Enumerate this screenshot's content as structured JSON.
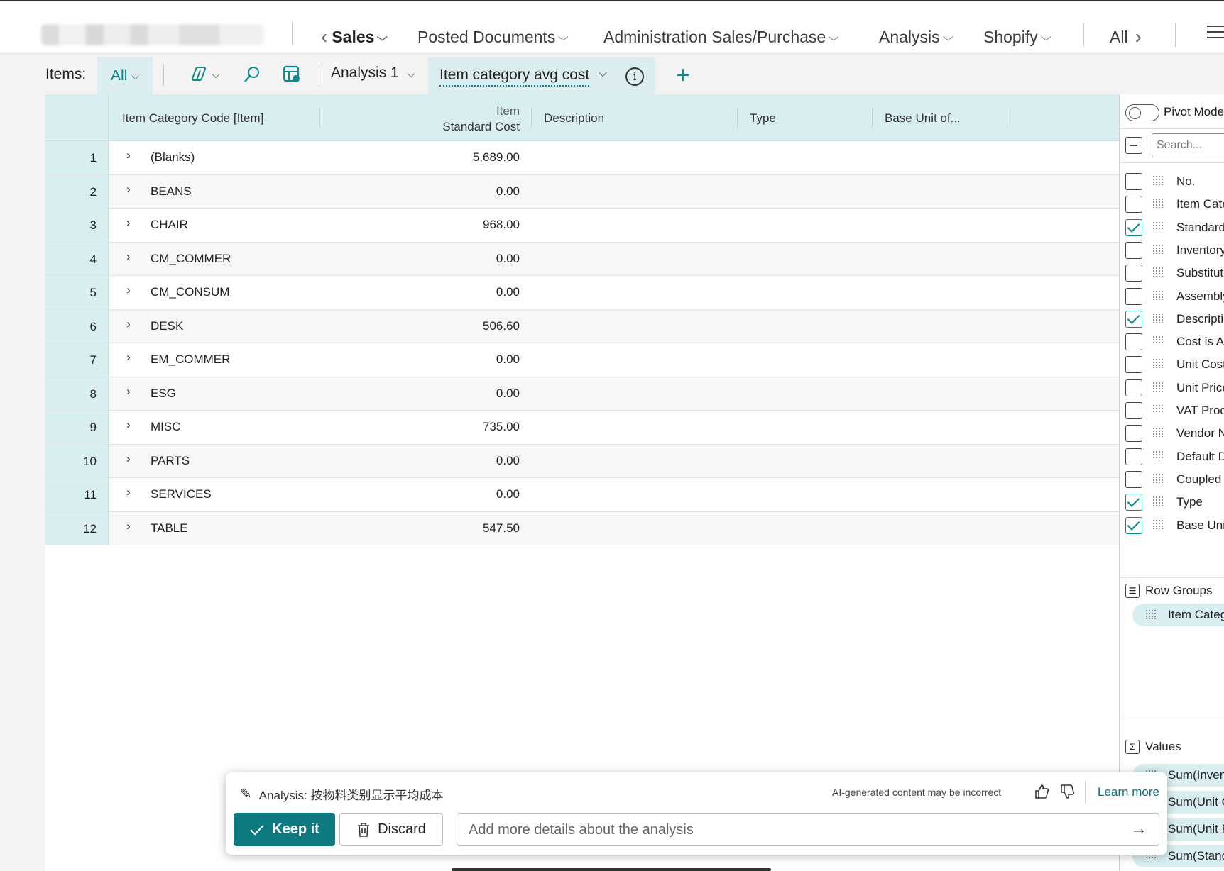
{
  "nav": {
    "items": [
      {
        "label": "Sales",
        "active": true
      },
      {
        "label": "Posted Documents"
      },
      {
        "label": "Administration Sales/Purchase"
      },
      {
        "label": "Analysis"
      },
      {
        "label": "Shopify"
      }
    ],
    "all_label": "All"
  },
  "toolbar": {
    "items_label": "Items:",
    "filter_value": "All",
    "analysis_label": "Analysis 1",
    "active_tab_label": "Item category avg cost"
  },
  "grid": {
    "headers": {
      "category": "Item Category Code [Item]",
      "cost_line1": "Item",
      "cost_line2": "Standard Cost",
      "description": "Description",
      "type": "Type",
      "base_unit": "Base Unit of..."
    },
    "rows": [
      {
        "num": "1",
        "code": "(Blanks)",
        "cost": "5,689.00"
      },
      {
        "num": "2",
        "code": "BEANS",
        "cost": "0.00"
      },
      {
        "num": "3",
        "code": "CHAIR",
        "cost": "968.00"
      },
      {
        "num": "4",
        "code": "CM_COMMER",
        "cost": "0.00"
      },
      {
        "num": "5",
        "code": "CM_CONSUM",
        "cost": "0.00"
      },
      {
        "num": "6",
        "code": "DESK",
        "cost": "506.60"
      },
      {
        "num": "7",
        "code": "EM_COMMER",
        "cost": "0.00"
      },
      {
        "num": "8",
        "code": "ESG",
        "cost": "0.00"
      },
      {
        "num": "9",
        "code": "MISC",
        "cost": "735.00"
      },
      {
        "num": "10",
        "code": "PARTS",
        "cost": "0.00"
      },
      {
        "num": "11",
        "code": "SERVICES",
        "cost": "0.00"
      },
      {
        "num": "12",
        "code": "TABLE",
        "cost": "547.50"
      }
    ]
  },
  "side": {
    "pivot_label": "Pivot Mode",
    "search_placeholder": "Search...",
    "columns": [
      {
        "label": "No.",
        "checked": false
      },
      {
        "label": "Item Category Code",
        "checked": false
      },
      {
        "label": "Standard Cost",
        "checked": true
      },
      {
        "label": "Inventory",
        "checked": false
      },
      {
        "label": "Substitutes Exist",
        "checked": false
      },
      {
        "label": "Assembly BOM",
        "checked": false
      },
      {
        "label": "Description",
        "checked": true
      },
      {
        "label": "Cost is Adjusted",
        "checked": false
      },
      {
        "label": "Unit Cost",
        "checked": false
      },
      {
        "label": "Unit Price",
        "checked": false
      },
      {
        "label": "VAT Prod. Posting Group",
        "checked": false
      },
      {
        "label": "Vendor No.",
        "checked": false
      },
      {
        "label": "Default Deferral Template",
        "checked": false
      },
      {
        "label": "Coupled to Dataverse",
        "checked": false
      },
      {
        "label": "Type",
        "checked": true
      },
      {
        "label": "Base Unit of Measure",
        "checked": true
      }
    ],
    "row_groups_label": "Row Groups",
    "row_groups": [
      "Item Category Code"
    ],
    "values_label": "Values",
    "values": [
      "Sum(Inventory)",
      "Sum(Unit Cost)",
      "Sum(Unit Price)",
      "Sum(Standard Cost)"
    ]
  },
  "copilot": {
    "title": "Analysis: 按物料类别显示平均成本",
    "disclaimer": "AI-generated content may be incorrect",
    "learn_more": "Learn more",
    "keep_label": "Keep it",
    "discard_label": "Discard",
    "input_placeholder": "Add more details about the analysis"
  },
  "colors": {
    "accent": "#0a8a8f",
    "header_bg": "#d9eef1",
    "keep_bg": "#0c7a80"
  }
}
